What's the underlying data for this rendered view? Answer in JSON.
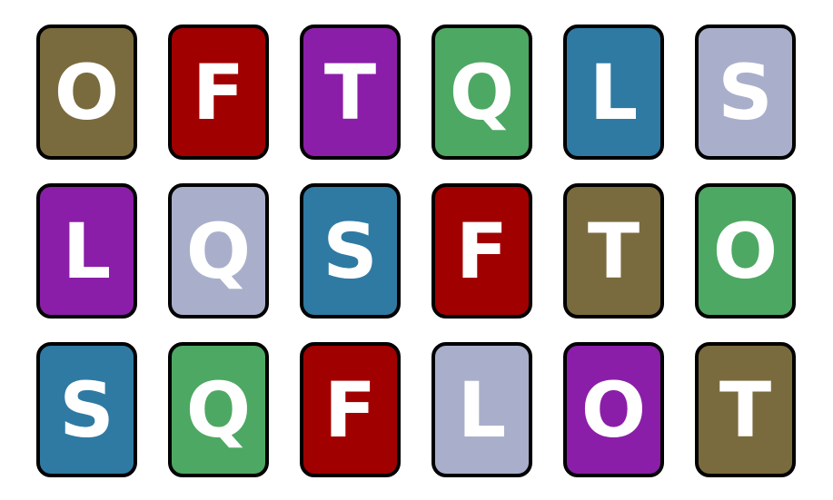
{
  "colors": {
    "olive": "#7a6b3e",
    "red": "#a10000",
    "purple": "#8b1ea8",
    "green": "#4da863",
    "blue": "#2f7aa3",
    "lavender": "#a9afcb"
  },
  "cards": [
    {
      "letter": "O",
      "color": "olive"
    },
    {
      "letter": "F",
      "color": "red"
    },
    {
      "letter": "T",
      "color": "purple"
    },
    {
      "letter": "Q",
      "color": "green"
    },
    {
      "letter": "L",
      "color": "blue"
    },
    {
      "letter": "S",
      "color": "lavender"
    },
    {
      "letter": "L",
      "color": "purple"
    },
    {
      "letter": "Q",
      "color": "lavender"
    },
    {
      "letter": "S",
      "color": "blue"
    },
    {
      "letter": "F",
      "color": "red"
    },
    {
      "letter": "T",
      "color": "olive"
    },
    {
      "letter": "O",
      "color": "green"
    },
    {
      "letter": "S",
      "color": "blue"
    },
    {
      "letter": "Q",
      "color": "green"
    },
    {
      "letter": "F",
      "color": "red"
    },
    {
      "letter": "L",
      "color": "lavender"
    },
    {
      "letter": "O",
      "color": "purple"
    },
    {
      "letter": "T",
      "color": "olive"
    }
  ]
}
